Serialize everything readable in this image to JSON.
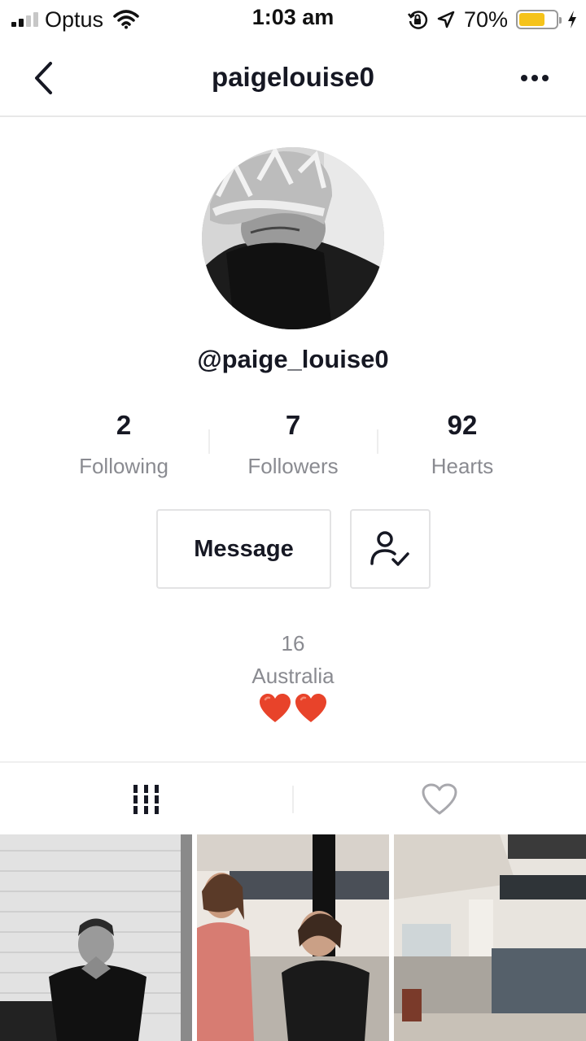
{
  "status_bar": {
    "carrier": "Optus",
    "time": "1:03 am",
    "battery_percent": "70%",
    "battery_level": 0.7,
    "signal_bars": 2
  },
  "nav": {
    "title": "paigelouise0"
  },
  "profile": {
    "handle": "@paige_louise0",
    "stats": [
      {
        "value": "2",
        "label": "Following"
      },
      {
        "value": "7",
        "label": "Followers"
      },
      {
        "value": "92",
        "label": "Hearts"
      }
    ],
    "message_label": "Message",
    "bio": {
      "age": "16",
      "location": "Australia",
      "emoji_icons": [
        "heart-icon",
        "heart-icon"
      ]
    }
  },
  "tabs": [
    {
      "icon": "grid-bars-icon",
      "selected": true
    },
    {
      "icon": "heart-outline-icon",
      "selected": false
    }
  ],
  "colors": {
    "text_primary": "#161823",
    "text_secondary": "#8a8b91",
    "heart_red": "#e8432a",
    "battery_yellow": "#f5c31a"
  }
}
